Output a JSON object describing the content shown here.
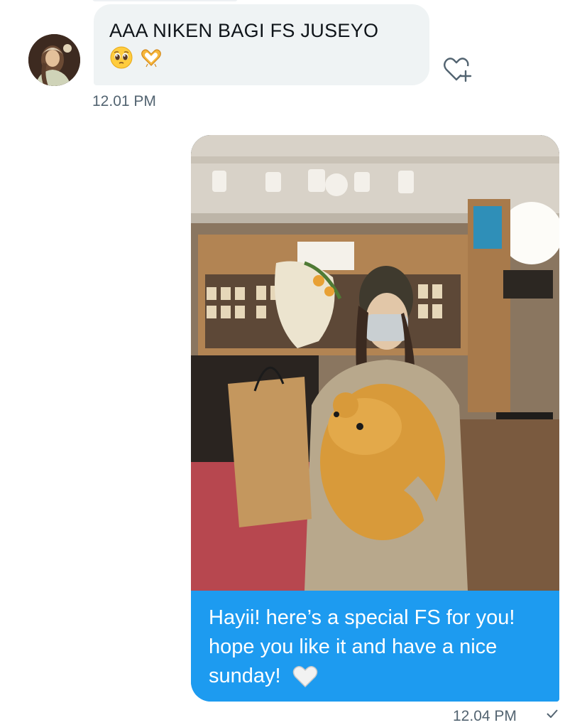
{
  "conversation": {
    "incoming": {
      "text": "AAA NIKEN BAGI FS JUSEYO",
      "emojis": [
        "pleading-face-emoji",
        "heart-hands-emoji"
      ],
      "timestamp": "12.01 PM",
      "react_icon": "add-reaction-heart-icon"
    },
    "outgoing": {
      "image": "photo-person-with-bouquet-and-teddy-bear",
      "text": "Hayii! here’s a special FS for you! hope you like it and have a nice sunday!",
      "emoji": "white-heart-emoji",
      "timestamp": "12.04 PM"
    }
  },
  "colors": {
    "incoming_bubble": "#eff3f4",
    "outgoing_bubble": "#1d9bf0",
    "timestamp": "#536471",
    "text_dark": "#0f1419"
  }
}
